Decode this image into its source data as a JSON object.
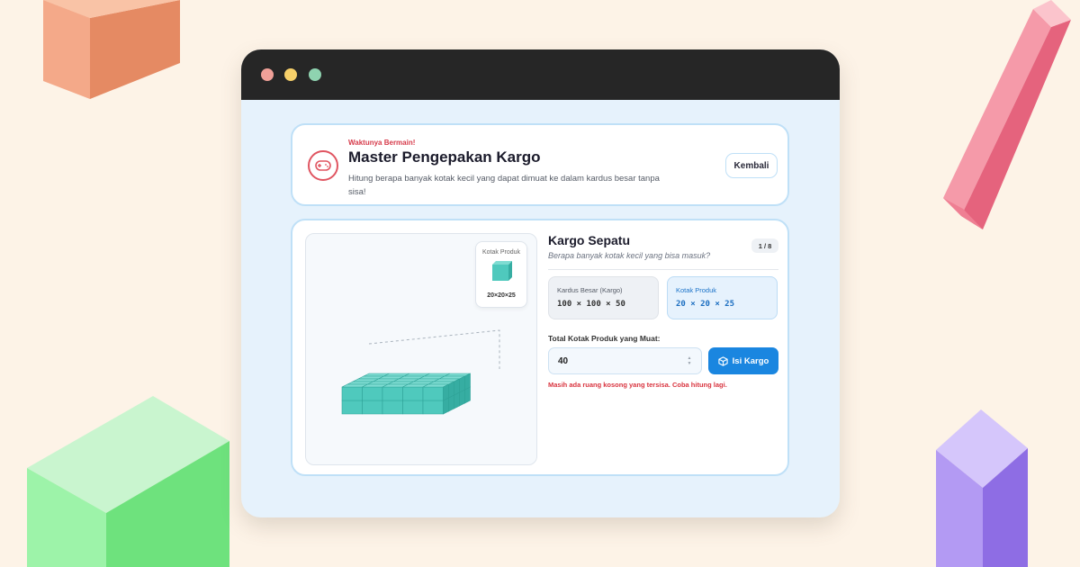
{
  "header": {
    "eyebrow": "Waktunya Bermain!",
    "title": "Master Pengepakan Kargo",
    "description": "Hitung berapa banyak kotak kecil yang dapat dimuat ke dalam kardus besar tanpa sisa!",
    "back_label": "Kembali",
    "icon": "gamepad-icon"
  },
  "preview": {
    "label": "Kotak Produk",
    "dims": "20×20×25"
  },
  "level": {
    "title": "Kargo Sepatu",
    "subtitle": "Berapa banyak kotak kecil yang bisa masuk?",
    "progress": "1 / 8"
  },
  "cargo": {
    "big_label": "Kardus Besar (Kargo)",
    "big_dims": "100 × 100 × 50",
    "product_label": "Kotak Produk",
    "product_dims": "20 × 20 × 25"
  },
  "answer": {
    "label": "Total Kotak Produk yang Muat:",
    "value": "40",
    "button_label": "Isi Kargo",
    "button_icon": "box-icon",
    "feedback": "Masih ada ruang kosong yang tersisa. Coba hitung lagi."
  },
  "colors": {
    "accent": "#1a86e0",
    "error": "#d9343f",
    "cube": "#4fc9bd"
  }
}
